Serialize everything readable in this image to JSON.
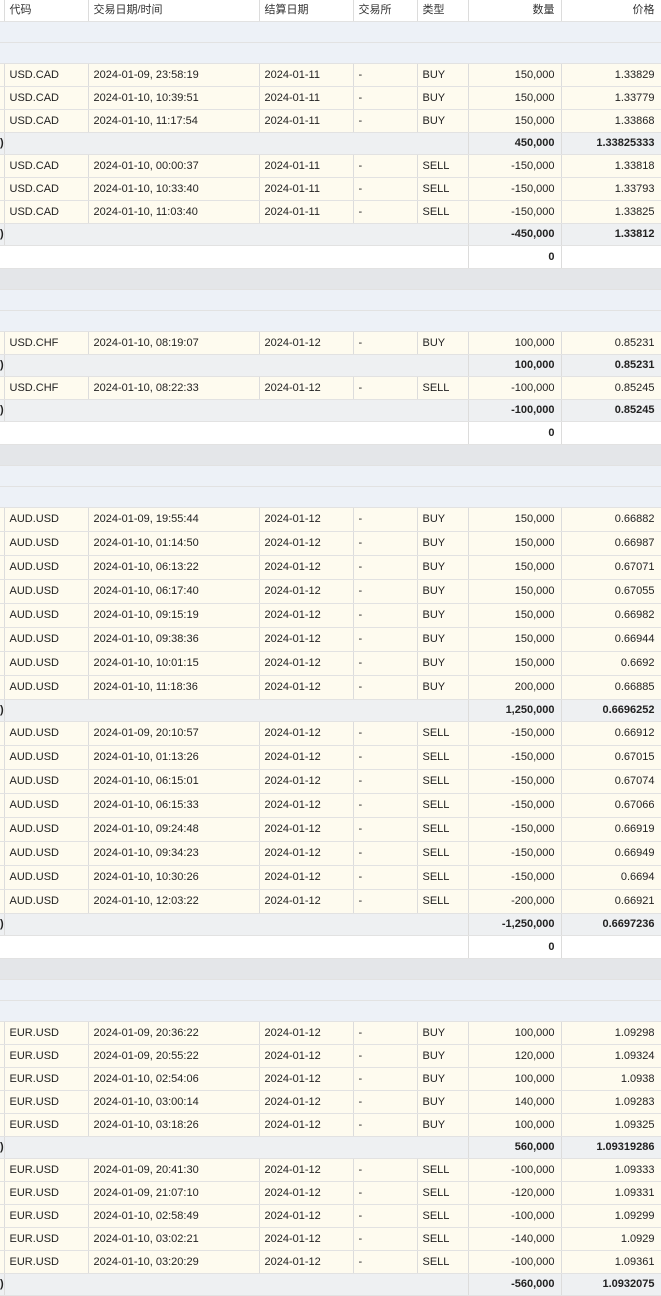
{
  "headers": [
    "代码",
    "交易日期/时间",
    "结算日期",
    "交易所",
    "类型",
    "数量",
    "价格"
  ],
  "groups": [
    {
      "buys": [
        {
          "symbol": "USD.CAD",
          "datetime": "2024-01-09, 23:58:19",
          "settle": "2024-01-11",
          "exchange": "-",
          "type": "BUY",
          "qty": "150,000",
          "price": "1.33829"
        },
        {
          "symbol": "USD.CAD",
          "datetime": "2024-01-10, 10:39:51",
          "settle": "2024-01-11",
          "exchange": "-",
          "type": "BUY",
          "qty": "150,000",
          "price": "1.33779"
        },
        {
          "symbol": "USD.CAD",
          "datetime": "2024-01-10, 11:17:54",
          "settle": "2024-01-11",
          "exchange": "-",
          "type": "BUY",
          "qty": "150,000",
          "price": "1.33868"
        }
      ],
      "buy_total": {
        "marker": ")",
        "qty": "450,000",
        "price": "1.33825333"
      },
      "sells": [
        {
          "symbol": "USD.CAD",
          "datetime": "2024-01-10, 00:00:37",
          "settle": "2024-01-11",
          "exchange": "-",
          "type": "SELL",
          "qty": "-150,000",
          "price": "1.33818"
        },
        {
          "symbol": "USD.CAD",
          "datetime": "2024-01-10, 10:33:40",
          "settle": "2024-01-11",
          "exchange": "-",
          "type": "SELL",
          "qty": "-150,000",
          "price": "1.33793"
        },
        {
          "symbol": "USD.CAD",
          "datetime": "2024-01-10, 11:03:40",
          "settle": "2024-01-11",
          "exchange": "-",
          "type": "SELL",
          "qty": "-150,000",
          "price": "1.33825"
        }
      ],
      "sell_total": {
        "marker": ")",
        "qty": "-450,000",
        "price": "1.33812"
      },
      "net": "0"
    },
    {
      "buys": [
        {
          "symbol": "USD.CHF",
          "datetime": "2024-01-10, 08:19:07",
          "settle": "2024-01-12",
          "exchange": "-",
          "type": "BUY",
          "qty": "100,000",
          "price": "0.85231"
        }
      ],
      "buy_total": {
        "marker": ")",
        "qty": "100,000",
        "price": "0.85231"
      },
      "sells": [
        {
          "symbol": "USD.CHF",
          "datetime": "2024-01-10, 08:22:33",
          "settle": "2024-01-12",
          "exchange": "-",
          "type": "SELL",
          "qty": "-100,000",
          "price": "0.85245"
        }
      ],
      "sell_total": {
        "marker": ")",
        "qty": "-100,000",
        "price": "0.85245"
      },
      "net": "0"
    },
    {
      "buys": [
        {
          "symbol": "AUD.USD",
          "datetime": "2024-01-09, 19:55:44",
          "settle": "2024-01-12",
          "exchange": "-",
          "type": "BUY",
          "qty": "150,000",
          "price": "0.66882"
        },
        {
          "symbol": "AUD.USD",
          "datetime": "2024-01-10, 01:14:50",
          "settle": "2024-01-12",
          "exchange": "-",
          "type": "BUY",
          "qty": "150,000",
          "price": "0.66987"
        },
        {
          "symbol": "AUD.USD",
          "datetime": "2024-01-10, 06:13:22",
          "settle": "2024-01-12",
          "exchange": "-",
          "type": "BUY",
          "qty": "150,000",
          "price": "0.67071"
        },
        {
          "symbol": "AUD.USD",
          "datetime": "2024-01-10, 06:17:40",
          "settle": "2024-01-12",
          "exchange": "-",
          "type": "BUY",
          "qty": "150,000",
          "price": "0.67055"
        },
        {
          "symbol": "AUD.USD",
          "datetime": "2024-01-10, 09:15:19",
          "settle": "2024-01-12",
          "exchange": "-",
          "type": "BUY",
          "qty": "150,000",
          "price": "0.66982"
        },
        {
          "symbol": "AUD.USD",
          "datetime": "2024-01-10, 09:38:36",
          "settle": "2024-01-12",
          "exchange": "-",
          "type": "BUY",
          "qty": "150,000",
          "price": "0.66944"
        },
        {
          "symbol": "AUD.USD",
          "datetime": "2024-01-10, 10:01:15",
          "settle": "2024-01-12",
          "exchange": "-",
          "type": "BUY",
          "qty": "150,000",
          "price": "0.6692"
        },
        {
          "symbol": "AUD.USD",
          "datetime": "2024-01-10, 11:18:36",
          "settle": "2024-01-12",
          "exchange": "-",
          "type": "BUY",
          "qty": "200,000",
          "price": "0.66885"
        }
      ],
      "buy_total": {
        "marker": ")",
        "qty": "1,250,000",
        "price": "0.6696252"
      },
      "sells": [
        {
          "symbol": "AUD.USD",
          "datetime": "2024-01-09, 20:10:57",
          "settle": "2024-01-12",
          "exchange": "-",
          "type": "SELL",
          "qty": "-150,000",
          "price": "0.66912"
        },
        {
          "symbol": "AUD.USD",
          "datetime": "2024-01-10, 01:13:26",
          "settle": "2024-01-12",
          "exchange": "-",
          "type": "SELL",
          "qty": "-150,000",
          "price": "0.67015"
        },
        {
          "symbol": "AUD.USD",
          "datetime": "2024-01-10, 06:15:01",
          "settle": "2024-01-12",
          "exchange": "-",
          "type": "SELL",
          "qty": "-150,000",
          "price": "0.67074"
        },
        {
          "symbol": "AUD.USD",
          "datetime": "2024-01-10, 06:15:33",
          "settle": "2024-01-12",
          "exchange": "-",
          "type": "SELL",
          "qty": "-150,000",
          "price": "0.67066"
        },
        {
          "symbol": "AUD.USD",
          "datetime": "2024-01-10, 09:24:48",
          "settle": "2024-01-12",
          "exchange": "-",
          "type": "SELL",
          "qty": "-150,000",
          "price": "0.66919"
        },
        {
          "symbol": "AUD.USD",
          "datetime": "2024-01-10, 09:34:23",
          "settle": "2024-01-12",
          "exchange": "-",
          "type": "SELL",
          "qty": "-150,000",
          "price": "0.66949"
        },
        {
          "symbol": "AUD.USD",
          "datetime": "2024-01-10, 10:30:26",
          "settle": "2024-01-12",
          "exchange": "-",
          "type": "SELL",
          "qty": "-150,000",
          "price": "0.6694"
        },
        {
          "symbol": "AUD.USD",
          "datetime": "2024-01-10, 12:03:22",
          "settle": "2024-01-12",
          "exchange": "-",
          "type": "SELL",
          "qty": "-200,000",
          "price": "0.66921"
        }
      ],
      "sell_total": {
        "marker": ")",
        "qty": "-1,250,000",
        "price": "0.6697236"
      },
      "net": "0"
    },
    {
      "buys": [
        {
          "symbol": "EUR.USD",
          "datetime": "2024-01-09, 20:36:22",
          "settle": "2024-01-12",
          "exchange": "-",
          "type": "BUY",
          "qty": "100,000",
          "price": "1.09298"
        },
        {
          "symbol": "EUR.USD",
          "datetime": "2024-01-09, 20:55:22",
          "settle": "2024-01-12",
          "exchange": "-",
          "type": "BUY",
          "qty": "120,000",
          "price": "1.09324"
        },
        {
          "symbol": "EUR.USD",
          "datetime": "2024-01-10, 02:54:06",
          "settle": "2024-01-12",
          "exchange": "-",
          "type": "BUY",
          "qty": "100,000",
          "price": "1.0938"
        },
        {
          "symbol": "EUR.USD",
          "datetime": "2024-01-10, 03:00:14",
          "settle": "2024-01-12",
          "exchange": "-",
          "type": "BUY",
          "qty": "140,000",
          "price": "1.09283"
        },
        {
          "symbol": "EUR.USD",
          "datetime": "2024-01-10, 03:18:26",
          "settle": "2024-01-12",
          "exchange": "-",
          "type": "BUY",
          "qty": "100,000",
          "price": "1.09325"
        }
      ],
      "buy_total": {
        "marker": ")",
        "qty": "560,000",
        "price": "1.09319286"
      },
      "sells": [
        {
          "symbol": "EUR.USD",
          "datetime": "2024-01-09, 20:41:30",
          "settle": "2024-01-12",
          "exchange": "-",
          "type": "SELL",
          "qty": "-100,000",
          "price": "1.09333"
        },
        {
          "symbol": "EUR.USD",
          "datetime": "2024-01-09, 21:07:10",
          "settle": "2024-01-12",
          "exchange": "-",
          "type": "SELL",
          "qty": "-120,000",
          "price": "1.09331"
        },
        {
          "symbol": "EUR.USD",
          "datetime": "2024-01-10, 02:58:49",
          "settle": "2024-01-12",
          "exchange": "-",
          "type": "SELL",
          "qty": "-100,000",
          "price": "1.09299"
        },
        {
          "symbol": "EUR.USD",
          "datetime": "2024-01-10, 03:02:21",
          "settle": "2024-01-12",
          "exchange": "-",
          "type": "SELL",
          "qty": "-140,000",
          "price": "1.0929"
        },
        {
          "symbol": "EUR.USD",
          "datetime": "2024-01-10, 03:20:29",
          "settle": "2024-01-12",
          "exchange": "-",
          "type": "SELL",
          "qty": "-100,000",
          "price": "1.09361"
        }
      ],
      "sell_total": {
        "marker": ")",
        "qty": "-560,000",
        "price": "1.0932075"
      },
      "net": null
    }
  ]
}
